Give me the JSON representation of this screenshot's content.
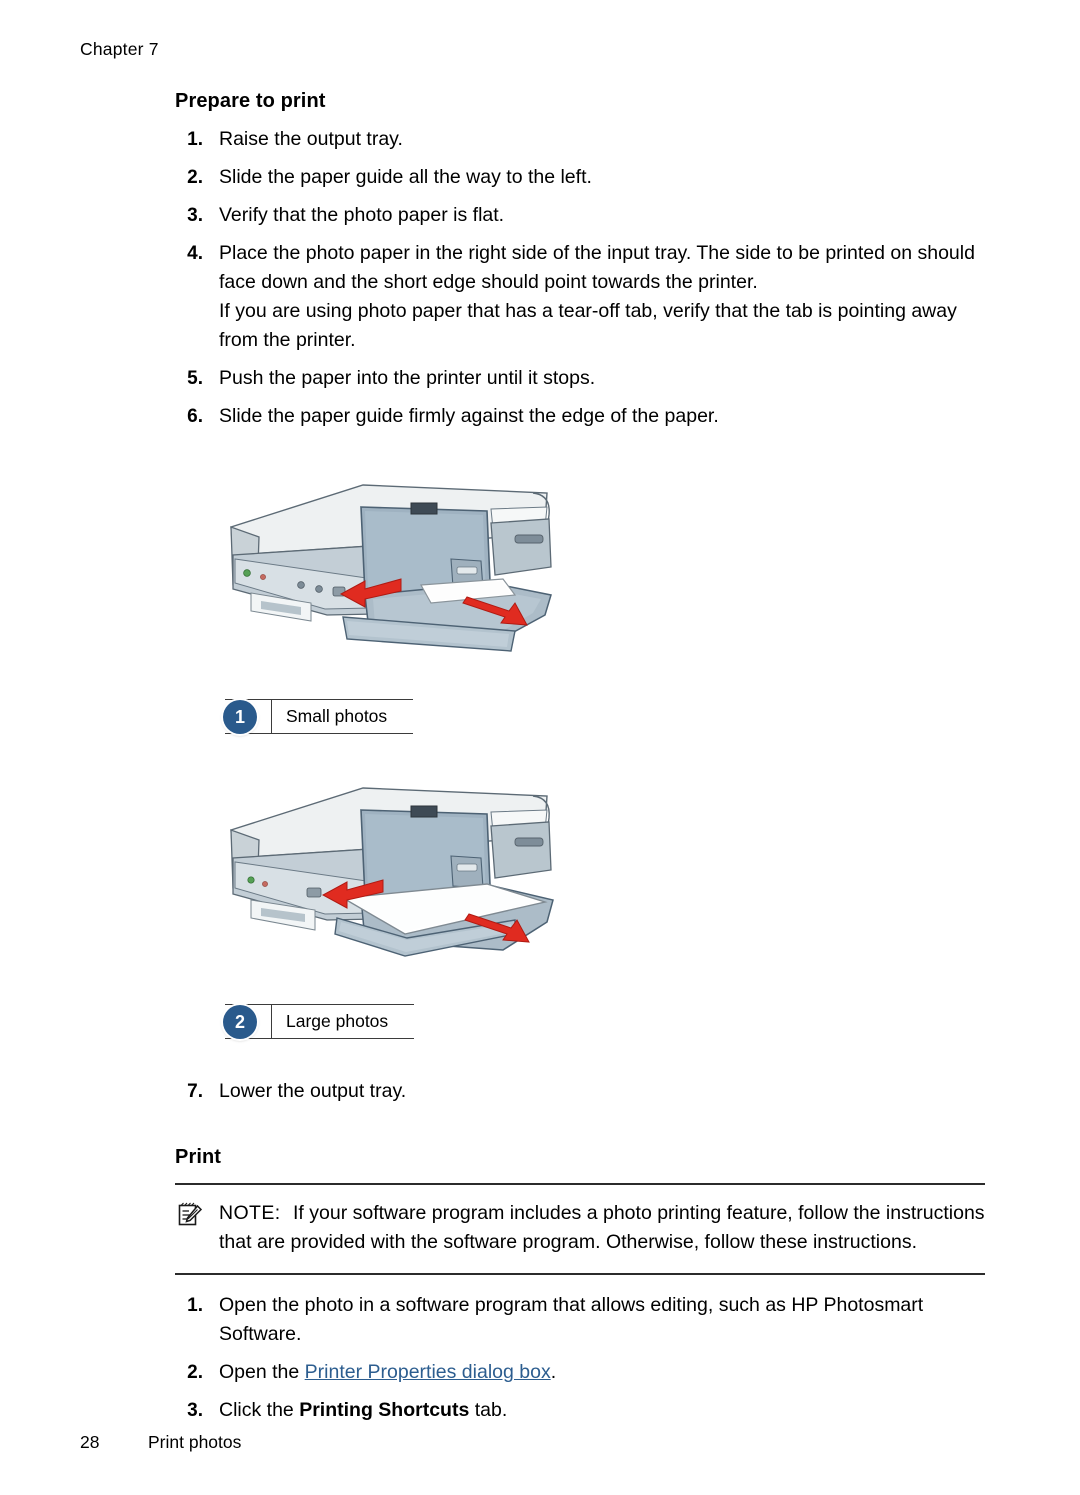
{
  "header": {
    "chapter": "Chapter 7"
  },
  "colors": {
    "link": "#2c5d8f",
    "badge": "#2a5a8c",
    "rule": "#2b2b2b",
    "printer_body": "#e7eaeb",
    "printer_tray": "#8ca2b4",
    "arrow_red": "#e02b20",
    "led_green": "#4f9b4f"
  },
  "prepare": {
    "heading": "Prepare to print",
    "steps": [
      {
        "num": "1.",
        "lines": [
          "Raise the output tray."
        ]
      },
      {
        "num": "2.",
        "lines": [
          "Slide the paper guide all the way to the left."
        ]
      },
      {
        "num": "3.",
        "lines": [
          "Verify that the photo paper is flat."
        ]
      },
      {
        "num": "4.",
        "lines": [
          "Place the photo paper in the right side of the input tray. The side to be printed on should face down and the short edge should point towards the printer.",
          "If you are using photo paper that has a tear-off tab, verify that the tab is pointing away from the printer."
        ]
      },
      {
        "num": "5.",
        "lines": [
          "Push the paper into the printer until it stops."
        ]
      },
      {
        "num": "6.",
        "lines": [
          "Slide the paper guide firmly against the edge of the paper."
        ]
      }
    ]
  },
  "figures": [
    {
      "badge": "1",
      "icon_name": "printer-illustration-small-photo",
      "caption_key": "1",
      "caption_value": "Small photos"
    },
    {
      "badge": "2",
      "icon_name": "printer-illustration-large-photo",
      "caption_key": "2",
      "caption_value": "Large photos"
    }
  ],
  "prepare_last": {
    "steps": [
      {
        "num": "7.",
        "lines": [
          "Lower the output tray."
        ]
      }
    ]
  },
  "print": {
    "heading": "Print",
    "note": {
      "icon_name": "note-clipboard-pencil-icon",
      "label": "NOTE:",
      "text": "If your software program includes a photo printing feature, follow the instructions that are provided with the software program. Otherwise, follow these instructions."
    },
    "steps": [
      {
        "num": "1.",
        "pre": "Open the photo in a software program that allows editing, such as HP Photosmart Software.",
        "link": "",
        "post": "",
        "bold": ""
      },
      {
        "num": "2.",
        "pre": "Open the ",
        "link": "Printer Properties dialog box",
        "post": ".",
        "bold": ""
      },
      {
        "num": "3.",
        "pre": "Click the ",
        "link": "",
        "bold": "Printing Shortcuts",
        "post": " tab."
      }
    ]
  },
  "footer": {
    "page_number": "28",
    "section": "Print photos"
  }
}
